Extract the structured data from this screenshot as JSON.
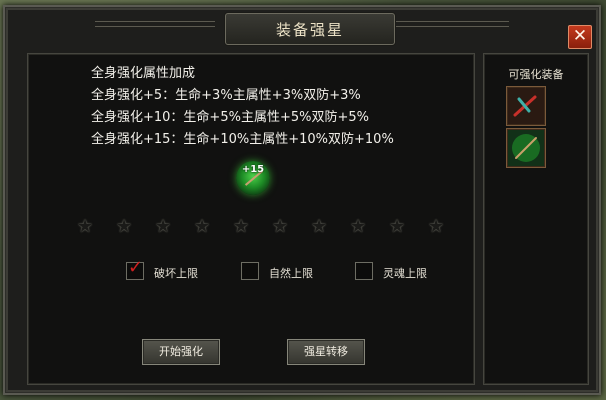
{
  "window": {
    "title": "装备强星",
    "close_label": "✕"
  },
  "bonus": {
    "heading": "全身强化属性加成",
    "lines": [
      "全身强化+5：生命+3%主属性+3%双防+3%",
      "全身强化+10：生命+5%主属性+5%双防+5%",
      "全身强化+15：生命+10%主属性+10%双防+10%"
    ]
  },
  "item": {
    "level": "+15",
    "icon": "green-sword-icon"
  },
  "stars": {
    "total": 10,
    "filled": 0,
    "glyph": "★"
  },
  "options": [
    {
      "label": "破坏上限",
      "checked": true
    },
    {
      "label": "自然上限",
      "checked": false
    },
    {
      "label": "灵魂上限",
      "checked": false
    }
  ],
  "buttons": {
    "start": "开始强化",
    "transfer": "强星转移"
  },
  "side": {
    "title": "可强化装备",
    "slots": [
      {
        "icon": "red-dagger-icon"
      },
      {
        "icon": "green-sword-icon"
      }
    ]
  },
  "colors": {
    "checkmark": "#d02020",
    "close": "#c43a1e",
    "item_glow": "#2e8a2a"
  }
}
